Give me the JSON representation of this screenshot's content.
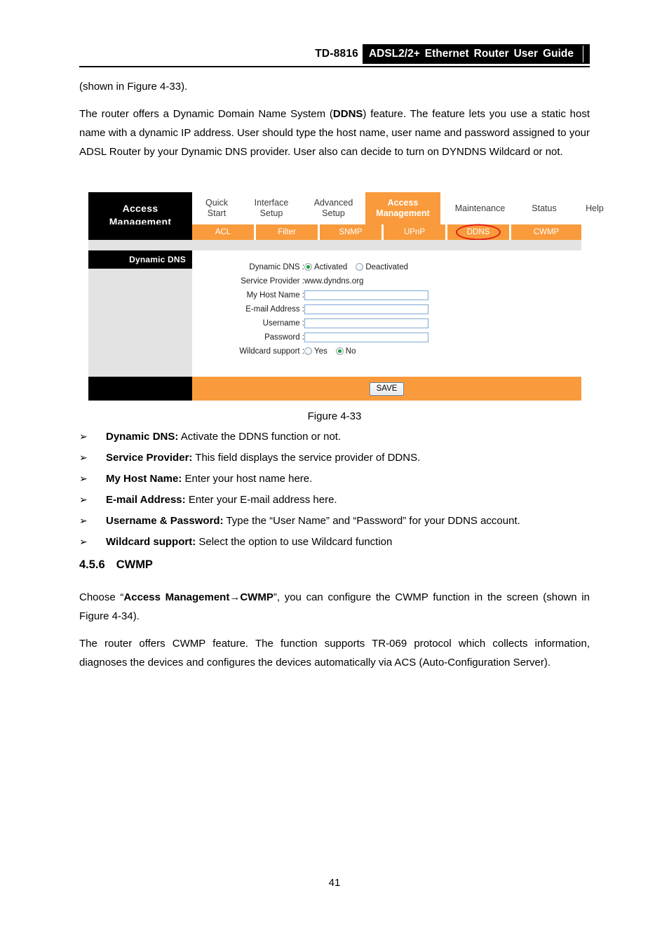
{
  "header": {
    "model": "TD-8816",
    "title_words": [
      "ADSL2/2+",
      "Ethernet",
      "Router",
      "User",
      "Guide"
    ]
  },
  "doc": {
    "continued_line": "(shown in Figure 4-33).",
    "intro_paragraph_pre": "The router offers a Dynamic Domain Name System (",
    "intro_bold": "DDNS",
    "intro_paragraph_post": ") feature. The feature lets you use a static host name with a dynamic IP address. User should type the host name, user name and password assigned to your ADSL Router by your Dynamic DNS provider. User also can decide to turn on DYNDNS Wildcard or not."
  },
  "figure": {
    "caption": "Figure 4-33",
    "brand_line1": "Access",
    "brand_line2": "Management",
    "main_nav": [
      {
        "line1": "Quick",
        "line2": "Start",
        "active": false
      },
      {
        "line1": "Interface",
        "line2": "Setup",
        "active": false
      },
      {
        "line1": "Advanced",
        "line2": "Setup",
        "active": false
      },
      {
        "line1": "Access",
        "line2": "Management",
        "active": true
      },
      {
        "line1": "Maintenance",
        "line2": "",
        "active": false
      },
      {
        "line1": "Status",
        "line2": "",
        "active": false
      },
      {
        "line1": "Help",
        "line2": "",
        "active": false
      }
    ],
    "sub_nav": [
      {
        "label": "ACL",
        "highlighted": false
      },
      {
        "label": "Filter",
        "highlighted": false
      },
      {
        "label": "SNMP",
        "highlighted": false
      },
      {
        "label": "UPnP",
        "highlighted": false
      },
      {
        "label": "DDNS",
        "highlighted": true
      },
      {
        "label": "CWMP",
        "highlighted": false
      }
    ],
    "panel_title": "Dynamic DNS",
    "form": {
      "dynamic_dns_label": "Dynamic DNS :",
      "dynamic_dns_option_activated": "Activated",
      "dynamic_dns_option_deactivated": "Deactivated",
      "dynamic_dns_selected": "Activated",
      "service_provider_label": "Service Provider :",
      "service_provider_value": "www.dyndns.org",
      "host_name_label": "My Host Name :",
      "host_name_value": "",
      "email_label": "E-mail Address :",
      "email_value": "",
      "username_label": "Username :",
      "username_value": "",
      "password_label": "Password :",
      "password_value": "",
      "wildcard_label": "Wildcard support :",
      "wildcard_option_yes": "Yes",
      "wildcard_option_no": "No",
      "wildcard_selected": "No"
    },
    "save_label": "SAVE",
    "colors": {
      "orange": "#F99B3C",
      "grey": "#E3E3E3",
      "black": "#000000",
      "highlight_ring": "#E21B10",
      "input_border": "#7FA8D4",
      "radio_dot": "#12A62A"
    }
  },
  "bullets": [
    {
      "marker": "➢",
      "term": "Dynamic DNS:",
      "desc": " Activate the DDNS function or not."
    },
    {
      "marker": "➢",
      "term": "Service Provider:",
      "desc": " This field displays the service provider of DDNS."
    },
    {
      "marker": "➢",
      "term": "My Host Name:",
      "desc": " Enter your host name here."
    },
    {
      "marker": "➢",
      "term": "E-mail Address:",
      "desc": " Enter your E-mail address here."
    },
    {
      "marker": "➢",
      "term": "Username & Password:",
      "desc": " Type the “User Name” and “Password” for your DDNS account."
    },
    {
      "marker": "➢",
      "term": "Wildcard support:",
      "desc": " Select the option to use Wildcard function"
    }
  ],
  "section": {
    "number": "4.5.6",
    "title": "CWMP",
    "choose_pre": "Choose “",
    "choose_bold": "Access Management→CWMP",
    "choose_post": "”, you can configure the CWMP function in the screen (shown in Figure 4-34).",
    "paragraph": "The router offers CWMP feature. The function supports TR-069 protocol which collects information, diagnoses the devices and configures the devices automatically via ACS (Auto-Configuration Server)."
  },
  "footer": {
    "page_number": "41"
  }
}
